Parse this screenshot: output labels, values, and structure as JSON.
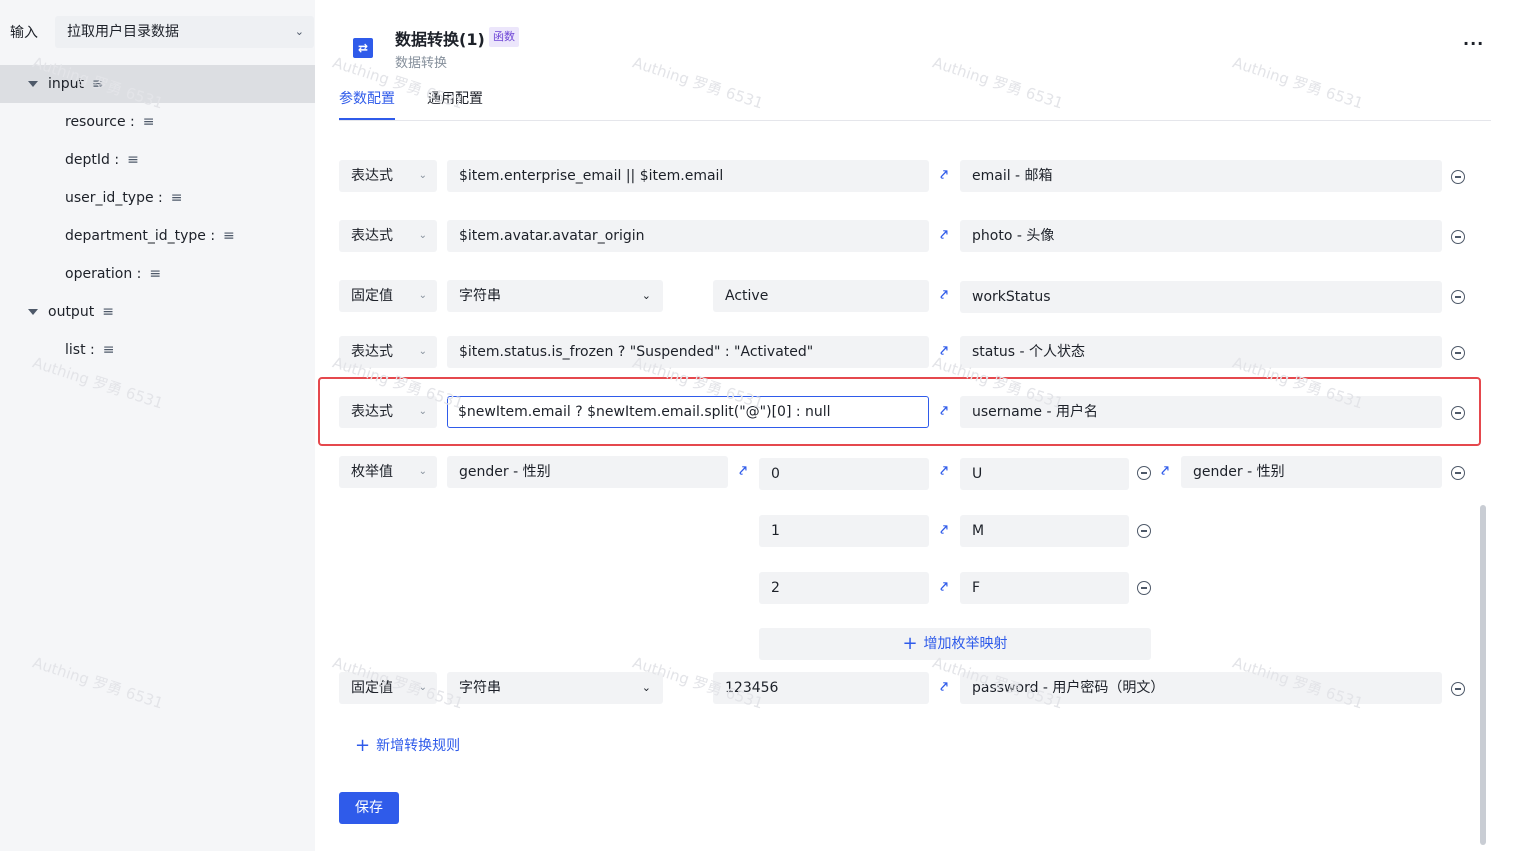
{
  "sidebar": {
    "input_label": "输入",
    "select_value": "拉取用户目录数据",
    "tree": [
      {
        "label": "input"
      },
      {
        "label": "resource :"
      },
      {
        "label": "deptId :"
      },
      {
        "label": "user_id_type :"
      },
      {
        "label": "department_id_type :"
      },
      {
        "label": "operation :"
      },
      {
        "label": "output"
      },
      {
        "label": "list :"
      }
    ]
  },
  "header": {
    "title": "数据转换(1)",
    "tag": "函数",
    "subtitle": "数据转换",
    "more": "···",
    "tabs": [
      "参数配置",
      "通用配置"
    ]
  },
  "rules": [
    {
      "type": "表达式",
      "source": "$item.enterprise_email || $item.email",
      "target": "email - 邮箱"
    },
    {
      "type": "表达式",
      "source": "$item.avatar.avatar_origin",
      "target": "photo - 头像"
    },
    {
      "type": "固定值",
      "value_type": "字符串",
      "value": "Active",
      "target": "workStatus"
    },
    {
      "type": "表达式",
      "source": "$item.status.is_frozen ? \"Suspended\" : \"Activated\"",
      "target": "status - 个人状态"
    },
    {
      "type": "表达式",
      "source": "$newItem.email ? $newItem.email.split(\"@\")[0] : null",
      "target": "username - 用户名"
    },
    {
      "type": "枚举值",
      "source": "gender - 性别",
      "target": "gender - 性别",
      "mappings": [
        {
          "from": "0",
          "to": "U"
        },
        {
          "from": "1",
          "to": "M"
        },
        {
          "from": "2",
          "to": "F"
        }
      ],
      "add_mapping": "增加枚举映射"
    },
    {
      "type": "固定值",
      "value_type": "字符串",
      "value": "123456",
      "target": "password - 用户密码（明文）"
    }
  ],
  "add_rule": "新增转换规则",
  "save": "保存",
  "watermark": "Authing 罗勇 6531",
  "colors": {
    "accent": "#2f5bea",
    "highlight": "#e5484d"
  }
}
